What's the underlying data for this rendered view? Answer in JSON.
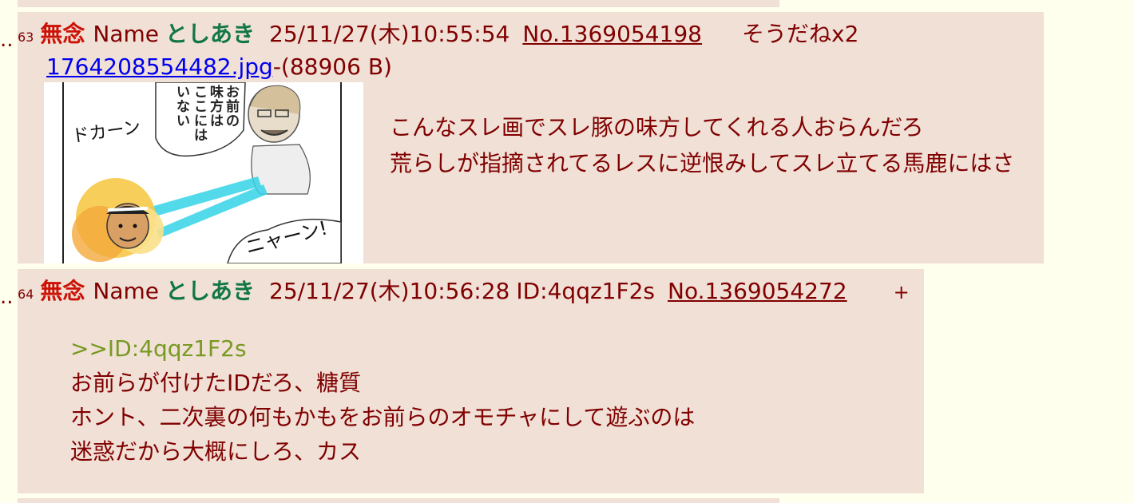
{
  "thread": {
    "prev_visible": true,
    "next_visible": true
  },
  "posts": [
    {
      "index": "63",
      "subject": "無念",
      "name_prefix": "Name",
      "name": "としあき",
      "date": "25/11/27(木)10:55:54",
      "id": "",
      "post_no": "No.1369054198",
      "sodane": "そうだねx2",
      "file_name": "1764208554482.jpg",
      "file_size": "-(88906 B)",
      "image": {
        "icon": "manga-thumbnail",
        "speech_bubble_text": "お前の味方はここにはいない",
        "sfx_left": "ドカーン",
        "sfx_right": "ニャーン!"
      },
      "body_lines": [
        "こんなスレ画でスレ豚の味方してくれる人おらんだろ",
        "荒らしが指摘されてるレスに逆恨みしてスレ立てる馬鹿にはさ"
      ]
    },
    {
      "index": "64",
      "subject": "無念",
      "name_prefix": "Name",
      "name": "としあき",
      "date": "25/11/27(木)10:56:28",
      "id": "ID:4qqz1F2s",
      "post_no": "No.1369054272",
      "sodane": "+",
      "quote": ">>ID:4qqz1F2s",
      "body_lines": [
        "お前らが付けたIDだろ、糖質",
        "ホント、二次裏の何もかもをお前らのオモチャにして遊ぶのは",
        "迷惑だから大概にしろ、カス"
      ]
    }
  ],
  "colors": {
    "page_bg": "#ffffee",
    "reply_bg": "#f0e0d6",
    "text": "#800000",
    "subject": "#cc1105",
    "name": "#117743",
    "quote": "#789922",
    "link": "#0000ee"
  }
}
